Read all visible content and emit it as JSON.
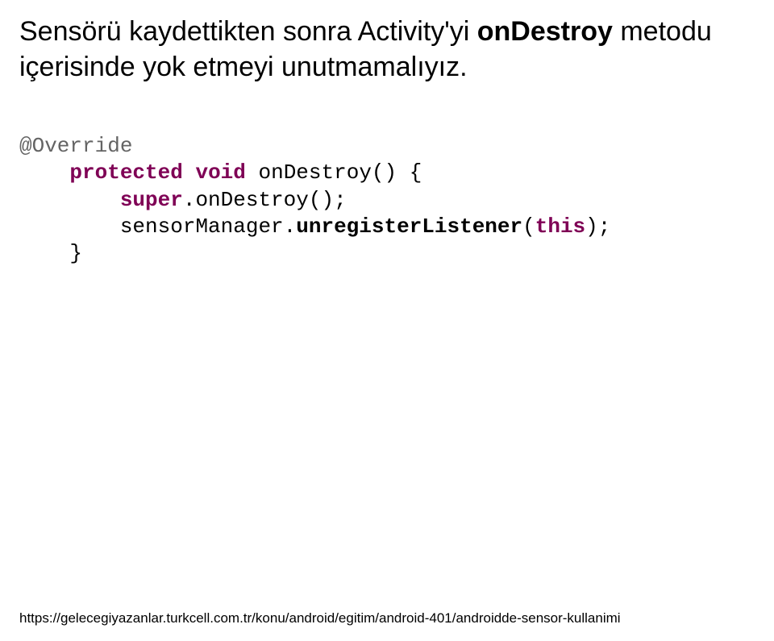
{
  "heading": {
    "part1": "Sensörü kaydettikten sonra Activity'yi ",
    "bold1": "onDestroy",
    "part2": " metodu içerisinde yok etmeyi unutmamalıyız."
  },
  "code": {
    "annotation": "@Override",
    "kw_protected": "protected",
    "kw_void": "void",
    "fn_name": " onDestroy() {",
    "kw_super": "super",
    "super_call": ".onDestroy();",
    "manager": "sensorManager.",
    "unreg": "unregisterListener",
    "kw_this": "this",
    "close_paren": ");",
    "close_brace": "}"
  },
  "footer": "https://gelecegiyazanlar.turkcell.com.tr/konu/android/egitim/android-401/androidde-sensor-kullanimi"
}
